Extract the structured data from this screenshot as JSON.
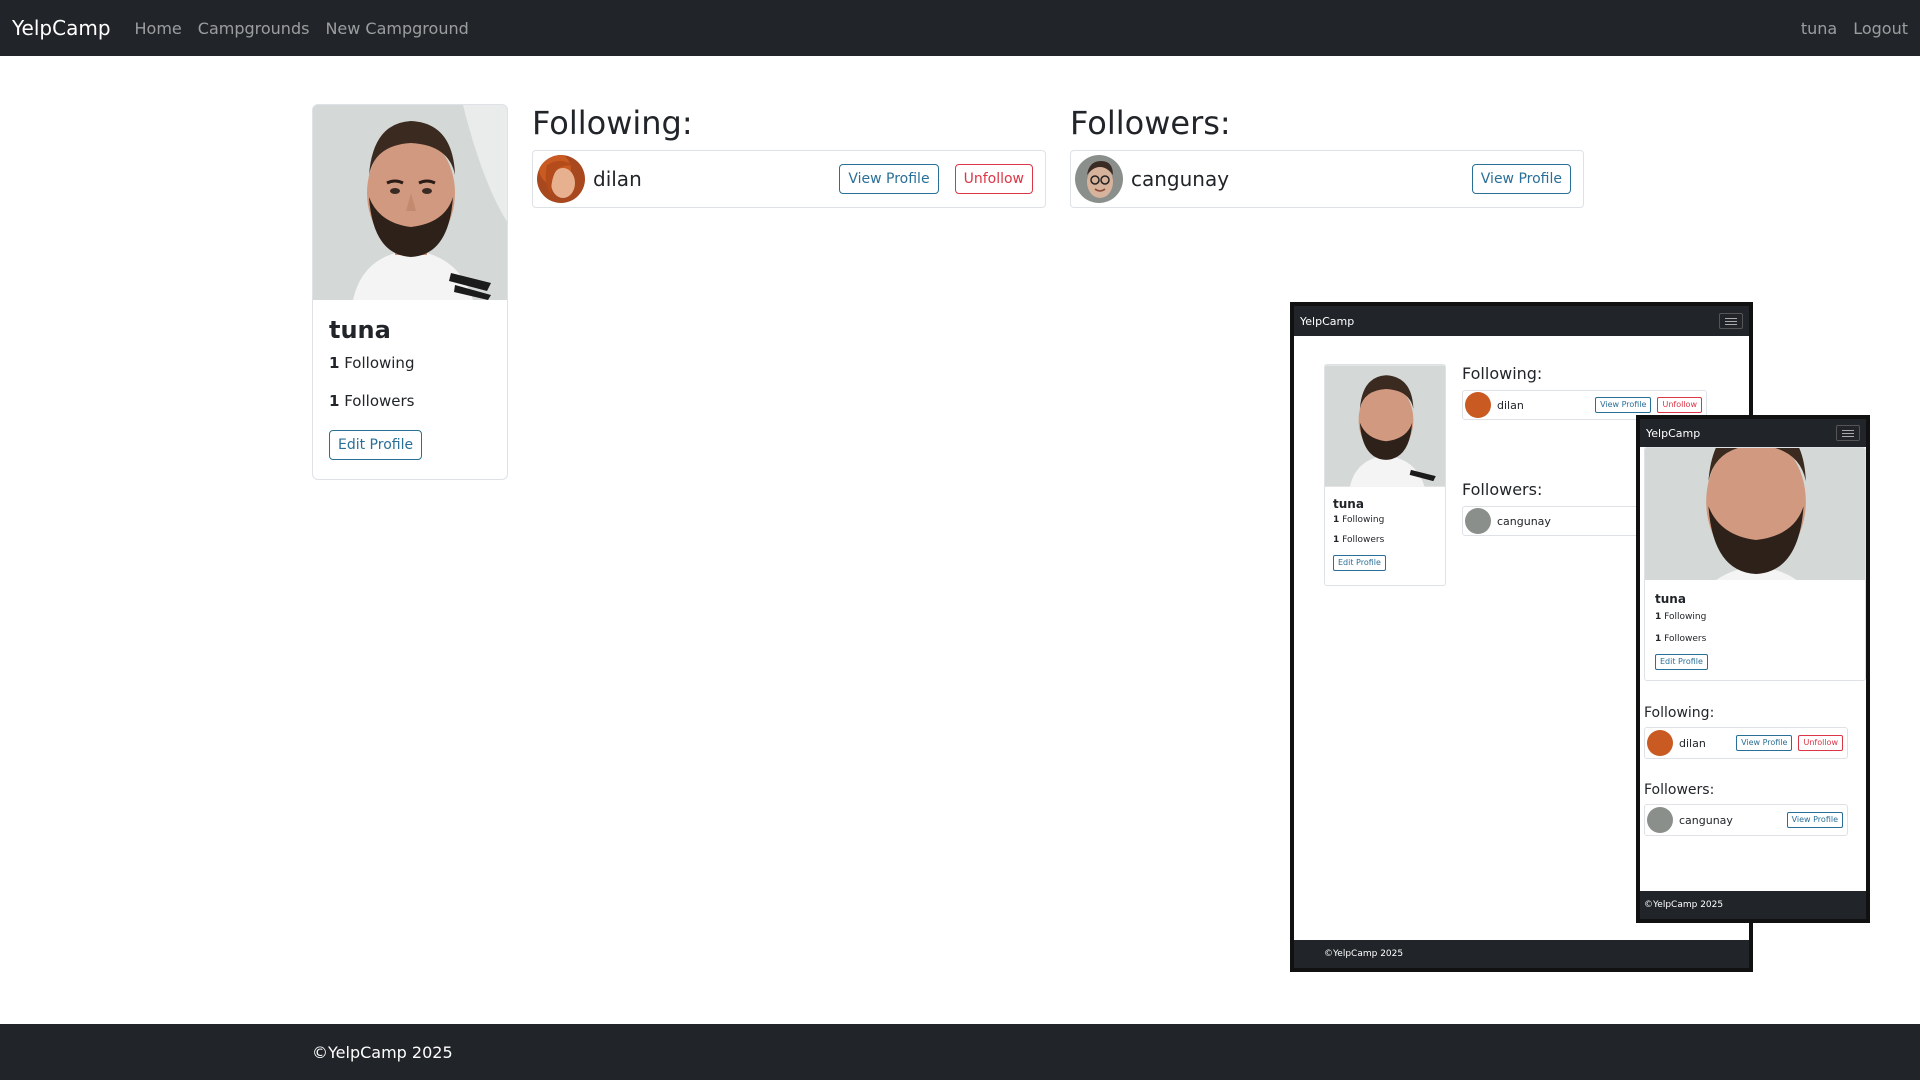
{
  "navbar": {
    "brand": "YelpCamp",
    "links": [
      "Home",
      "Campgrounds",
      "New Campground"
    ],
    "username": "tuna",
    "logout": "Logout"
  },
  "profile": {
    "name": "tuna",
    "following_count": "1",
    "following_label": "Following",
    "followers_count": "1",
    "followers_label": "Followers",
    "edit_button": "Edit Profile"
  },
  "following": {
    "title": "Following:",
    "items": [
      {
        "name": "dilan",
        "view_label": "View Profile",
        "unfollow_label": "Unfollow"
      }
    ]
  },
  "followers": {
    "title": "Followers:",
    "items": [
      {
        "name": "cangunay",
        "view_label": "View Profile"
      }
    ]
  },
  "footer": {
    "text": "©YelpCamp 2025"
  },
  "colors": {
    "navbar_bg": "#212529",
    "primary_outline": "#2a6f97",
    "danger_outline": "#dc3545"
  }
}
